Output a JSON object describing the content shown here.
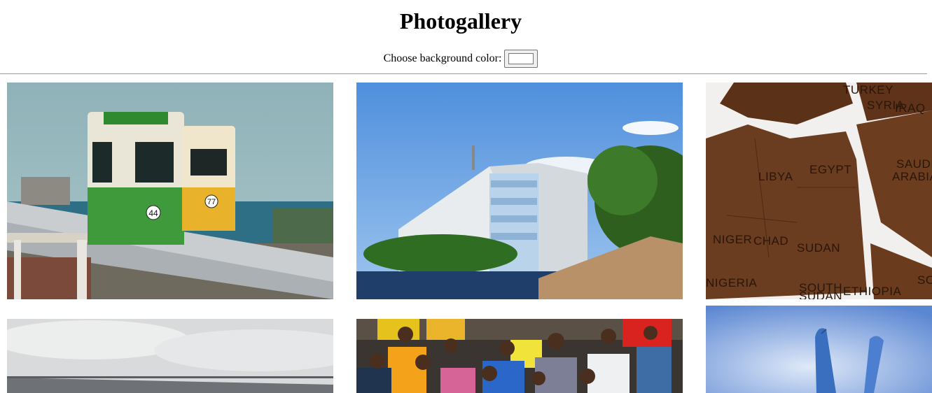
{
  "page": {
    "title": "Photogallery",
    "color_label": "Choose background color:",
    "color_value": "#ffffff"
  },
  "gallery": {
    "photos": [
      {
        "subject": "tram-photo",
        "tram_numbers": [
          "44",
          "77"
        ]
      },
      {
        "subject": "building-photo"
      },
      {
        "subject": "map-photo",
        "map_labels": [
          "TURKEY",
          "SYRIA",
          "IRAQ",
          "LIBYA",
          "EGYPT",
          "SAUDI",
          "ARABIA",
          "NIGER",
          "CHAD",
          "SUDAN",
          "SOUTH",
          "SUDAN",
          "ETHIOPIA",
          "NIGERIA",
          "SO"
        ]
      },
      {
        "subject": "stadium-photo"
      },
      {
        "subject": "crowd-photo"
      },
      {
        "subject": "hand-photo"
      }
    ]
  },
  "colors": {
    "rule": "#9a9a9a",
    "page_background": "#ffffff"
  }
}
